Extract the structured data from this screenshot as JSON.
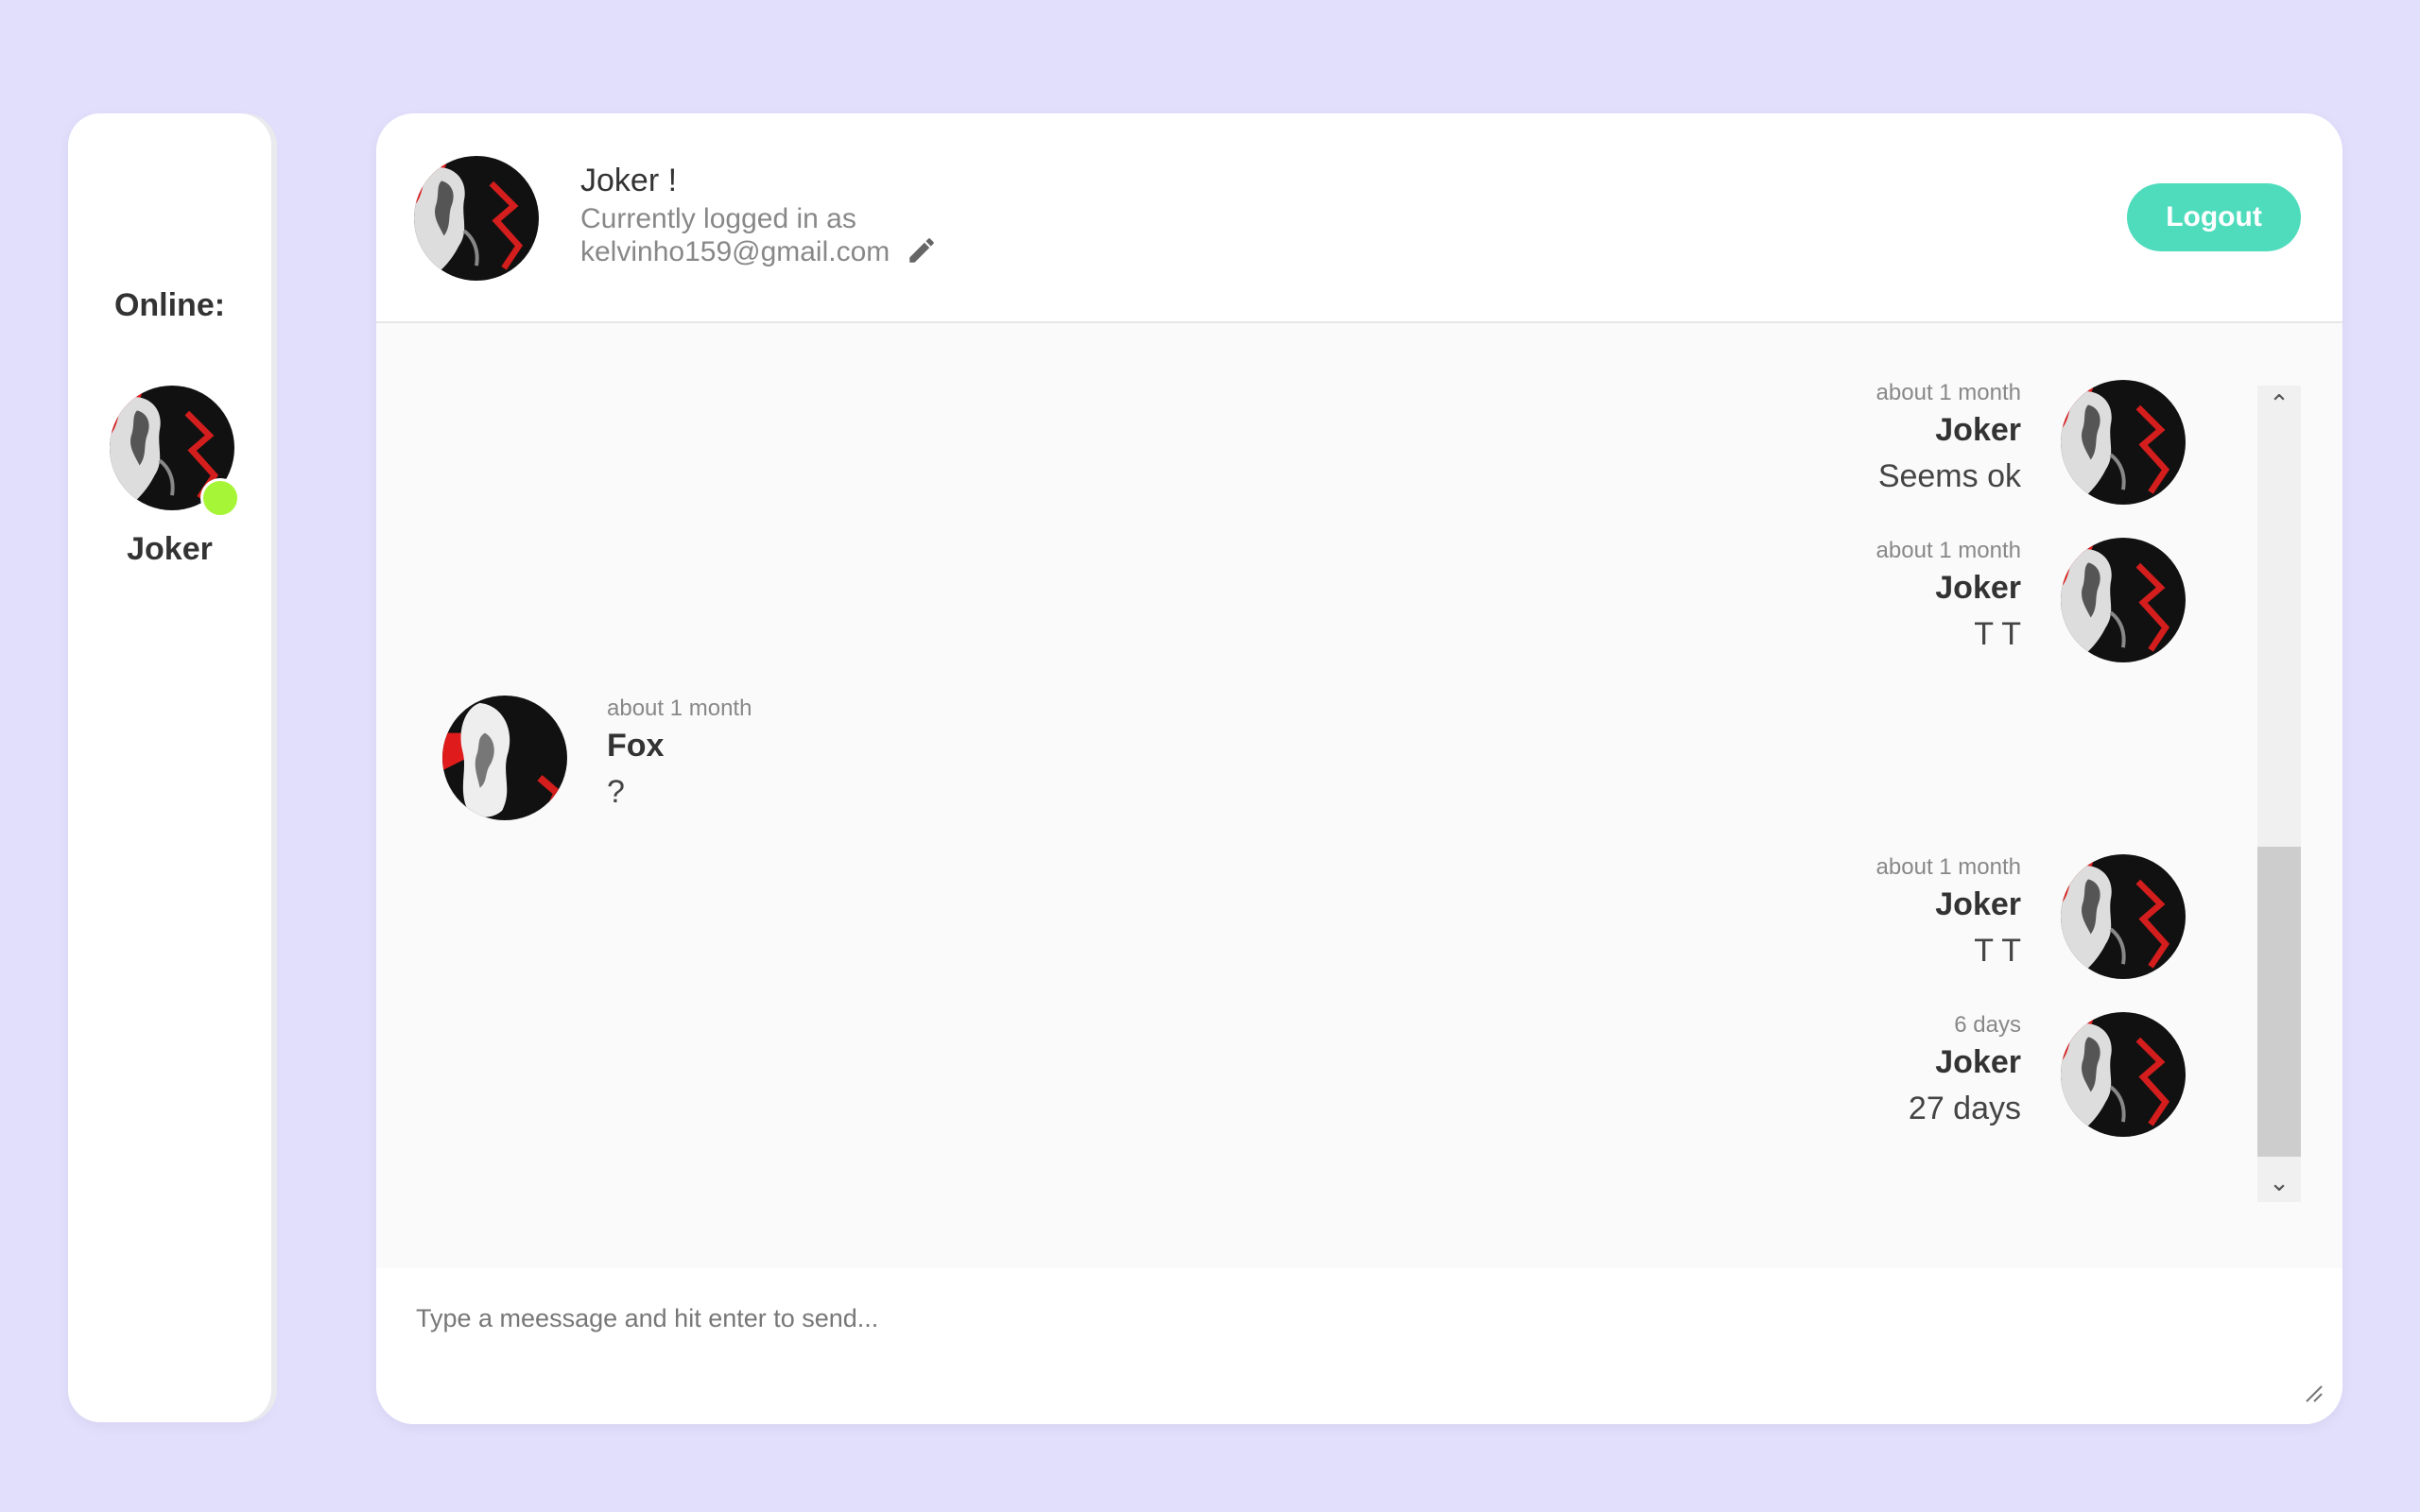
{
  "sidebar": {
    "title": "Online:",
    "users": [
      {
        "name": "Joker",
        "status": "online"
      }
    ]
  },
  "header": {
    "title": "Joker !",
    "subtitle": "Currently logged in as",
    "email": "kelvinho159@gmail.com",
    "logout_label": "Logout",
    "edit_icon": "pencil-icon"
  },
  "messages": [
    {
      "side": "right",
      "time": "about 1 month",
      "author": "Joker",
      "text": "Seems ok"
    },
    {
      "side": "right",
      "time": "about 1 month",
      "author": "Joker",
      "text": "T T"
    },
    {
      "side": "left",
      "time": "about 1 month",
      "author": "Fox",
      "text": "?"
    },
    {
      "side": "right",
      "time": "about 1 month",
      "author": "Joker",
      "text": "T T"
    },
    {
      "side": "right",
      "time": "6 days",
      "author": "Joker",
      "text": "27 days"
    }
  ],
  "composer": {
    "placeholder": "Type a meessage and hit enter to send..."
  },
  "colors": {
    "background": "#e2dffd",
    "accent": "#4fdcbd",
    "online": "#a6f536"
  }
}
